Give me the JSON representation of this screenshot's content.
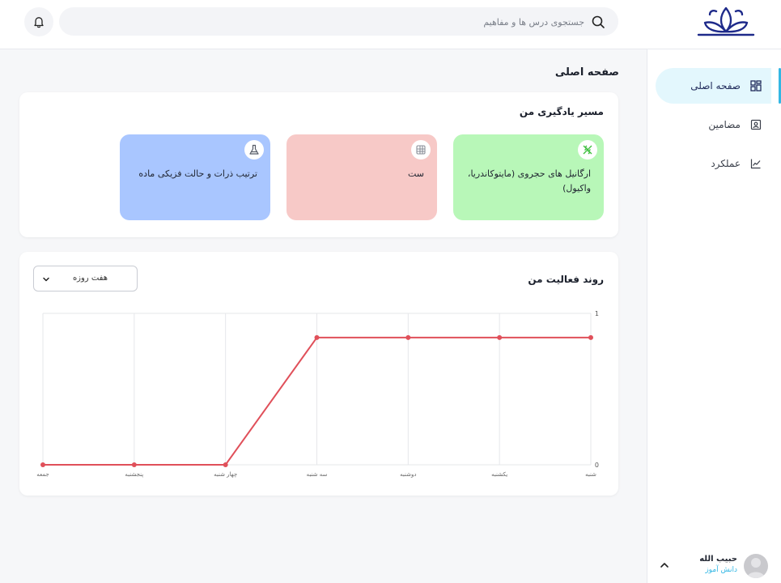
{
  "search": {
    "placeholder": "جستجوی درس ها و مفاهیم"
  },
  "sidebar": {
    "items": [
      {
        "label": "صفحه اصلی",
        "icon": "dashboard-icon",
        "active": true
      },
      {
        "label": "مضامین",
        "icon": "contacts-book-icon",
        "active": false
      },
      {
        "label": "عملکرد",
        "icon": "chart-line-icon",
        "active": false
      }
    ]
  },
  "user": {
    "name": "حبیب الله",
    "role": "دانش آموز"
  },
  "page": {
    "title": "صفحه اصلی"
  },
  "learning_path": {
    "title": "مسیر یادگیری من",
    "tiles": [
      {
        "label": "ارگانیل های حجروی (مایتوکاندریا، واکیول)",
        "icon": "dna-icon",
        "color": "#b8f7b8",
        "icon_color": "#3fbf3f"
      },
      {
        "label": "ست",
        "icon": "grid-icon",
        "color": "#f7c9c7",
        "icon_color": "#8a8f99"
      },
      {
        "label": "ترتیب ذرات و حالت فزیکی ماده",
        "icon": "flask-icon",
        "color": "#a9c6ff",
        "icon_color": "#555b66"
      }
    ]
  },
  "activity": {
    "title": "روند فعالیت من",
    "range_select": {
      "value": "هفت روزه"
    }
  },
  "chart_data": {
    "type": "line",
    "categories": [
      "شنبه",
      "یکشنبه",
      "دوشنبه",
      "سه شنبه",
      "چهار شنبه",
      "پنجشنبه",
      "جمعه"
    ],
    "series": [
      {
        "values": [
          0.84,
          0.84,
          0.84,
          0.84,
          0,
          0,
          0
        ]
      }
    ],
    "ylim": [
      0,
      1
    ],
    "yticks": [
      0,
      1
    ],
    "x_direction": "right-to-left",
    "grid": true,
    "line_color": "#e0505a"
  }
}
